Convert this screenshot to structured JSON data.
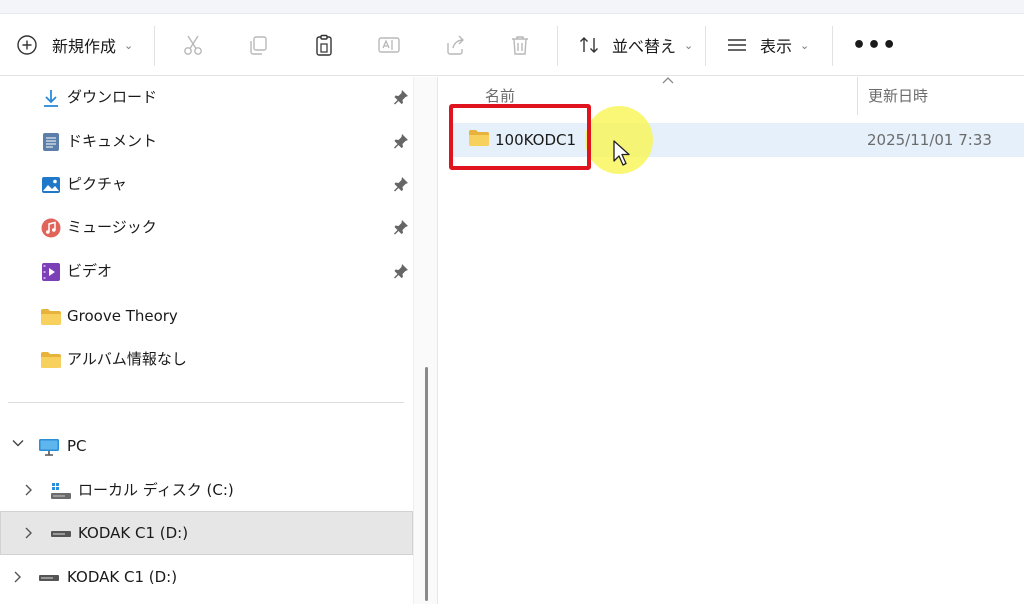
{
  "toolbar": {
    "new_label": "新規作成",
    "sort_label": "並べ替え",
    "view_label": "表示",
    "more_label": "•••"
  },
  "sidebar": {
    "quick_access": [
      {
        "label": "ダウンロード",
        "icon": "download-icon"
      },
      {
        "label": "ドキュメント",
        "icon": "documents-icon"
      },
      {
        "label": "ピクチャ",
        "icon": "pictures-icon"
      },
      {
        "label": "ミュージック",
        "icon": "music-icon"
      },
      {
        "label": "ビデオ",
        "icon": "videos-icon"
      },
      {
        "label": "Groove Theory",
        "icon": "folder-icon"
      },
      {
        "label": "アルバム情報なし",
        "icon": "folder-icon"
      }
    ],
    "pc_label": "PC",
    "drives": [
      {
        "label": "ローカル ディスク (C:)",
        "icon": "local-disk-icon"
      },
      {
        "label": "KODAK C1 (D:)",
        "icon": "usb-drive-icon",
        "selected": true
      }
    ],
    "removable_label": "KODAK C1 (D:)"
  },
  "content": {
    "columns": {
      "name": "名前",
      "date": "更新日時"
    },
    "files": [
      {
        "name": "100KODC1",
        "modified": "2025/11/01 7:33",
        "type": "folder"
      }
    ]
  },
  "colors": {
    "accent_blue": "#0067c0",
    "selection": "#e5f0fb",
    "highlight_red": "#e0141e",
    "cursor_glow": "#faf550",
    "folder_yellow": "#f5c94c"
  }
}
